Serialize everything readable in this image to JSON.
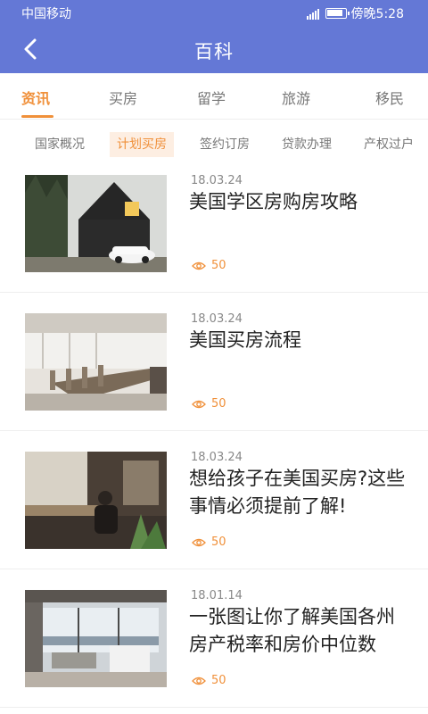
{
  "status_bar": {
    "carrier": "中国移动",
    "time": "傍晚5:28"
  },
  "header": {
    "title": "百科"
  },
  "main_tabs": [
    {
      "label": "资讯"
    },
    {
      "label": "买房"
    },
    {
      "label": "留学"
    },
    {
      "label": "旅游"
    },
    {
      "label": "移民"
    }
  ],
  "active_main_tab": "资讯",
  "sub_tabs": [
    {
      "label": "国家概况"
    },
    {
      "label": "计划买房"
    },
    {
      "label": "签约订房"
    },
    {
      "label": "贷款办理"
    },
    {
      "label": "产权过户"
    }
  ],
  "active_sub_tab": "计划买房",
  "articles": [
    {
      "date": "18.03.24",
      "title": "美国学区房购房攻略",
      "views": "50",
      "image": "modern-house-with-white-car"
    },
    {
      "date": "18.03.24",
      "title": "美国买房流程",
      "views": "50",
      "image": "conference-room"
    },
    {
      "date": "18.03.24",
      "title": "想给孩子在美国买房?这些事情必须提前了解!",
      "views": "50",
      "image": "office-with-person-at-desk"
    },
    {
      "date": "18.01.14",
      "title": "一张图让你了解美国各州房产税率和房价中位数",
      "views": "50",
      "image": "living-room-with-view"
    }
  ],
  "colors": {
    "header": "#6478d6",
    "accent": "#f0903a"
  }
}
